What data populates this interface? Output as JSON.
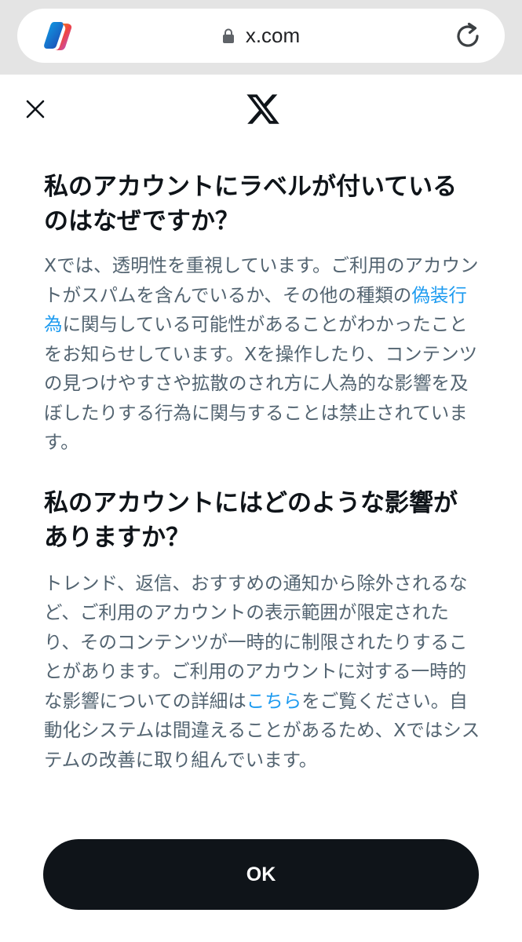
{
  "browser": {
    "url": "x.com",
    "icons": {
      "logo": "copilot-icon",
      "lock": "lock-icon",
      "reload": "reload-icon"
    }
  },
  "header": {
    "close_icon": "close-icon",
    "logo_icon": "x-logo-icon"
  },
  "section1": {
    "heading": "私のアカウントにラベルが付いているのはなぜですか？",
    "body_before_link": "Xでは、透明性を重視しています。ご利用のアカウントがスパムを含んでいるか、その他の種類の",
    "link": "偽装行為",
    "body_after_link": "に関与している可能性があることがわかったことをお知らせしています。Xを操作したり、コンテンツの見つけやすさや拡散のされ方に人為的な影響を及ぼしたりする行為に関与することは禁止されています。"
  },
  "section2": {
    "heading": "私のアカウントにはどのような影響がありますか？",
    "body_before_link": "トレンド、返信、おすすめの通知から除外されるなど、ご利用のアカウントの表示範囲が限定されたり、そのコンテンツが一時的に制限されたりすることがあります。ご利用のアカウントに対する一時的な影響についての詳細は",
    "link": "こちら",
    "body_after_link": "をご覧ください。自動化システムは間違えることがあるため、Xではシステムの改善に取り組んでいます。"
  },
  "ok_button": "OK",
  "colors": {
    "link": "#1d9bf0",
    "heading": "#0f1419",
    "body_text": "#536471",
    "button_bg": "#0f1419",
    "browser_bar": "#e4e4e4"
  }
}
